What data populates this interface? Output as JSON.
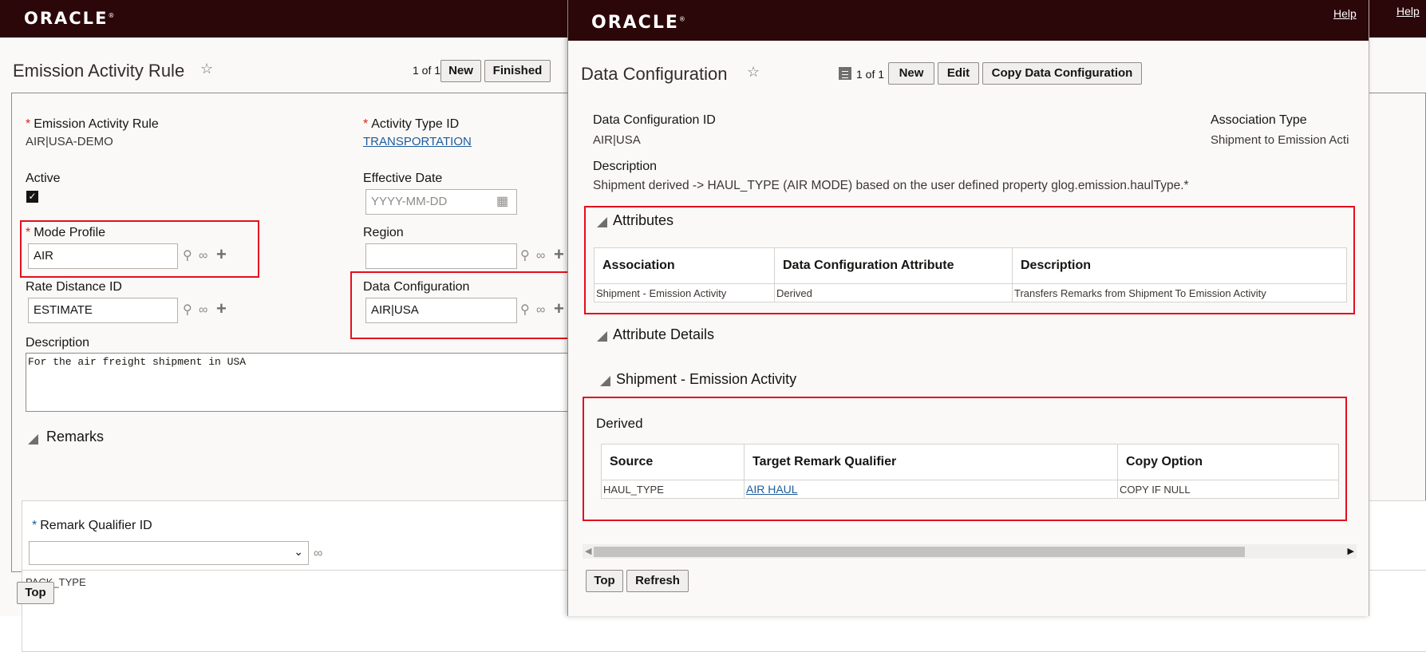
{
  "bg": {
    "logo": "ORACLE",
    "help": "Help",
    "title": "Emission Activity Rule",
    "pager": "1 of 1",
    "new_label": "New",
    "finished_label": "Finished",
    "fields": {
      "rule_label": "Emission Activity Rule",
      "rule_value": "AIR|USA-DEMO",
      "activity_type_label": "Activity Type ID",
      "activity_type_value": "TRANSPORTATION",
      "active_label": "Active",
      "active_checked": true,
      "effective_date_label": "Effective Date",
      "effective_date_placeholder": "YYYY-MM-DD",
      "mode_profile_label": "Mode Profile",
      "mode_profile_value": "AIR",
      "region_label": "Region",
      "region_value": "",
      "rate_distance_label": "Rate Distance ID",
      "rate_distance_value": "ESTIMATE",
      "data_config_label": "Data Configuration",
      "data_config_value": "AIR|USA",
      "description_label": "Description",
      "description_value": "For the air freight shipment in USA"
    },
    "remarks": {
      "section": "Remarks",
      "qualifier_label": "Remark Qualifier ID",
      "qualifier_value": "",
      "row_value": "PACK_TYPE"
    },
    "top_label": "Top"
  },
  "popup": {
    "logo": "ORACLE",
    "help": "Help",
    "title": "Data Configuration",
    "pager": "1 of 1",
    "new_label": "New",
    "edit_label": "Edit",
    "copy_label": "Copy Data Configuration",
    "id_label": "Data Configuration ID",
    "id_value": "AIR|USA",
    "assoc_type_label": "Association Type",
    "assoc_type_value": "Shipment to Emission Acti",
    "description_label": "Description",
    "description_value": "Shipment derived -> HAUL_TYPE (AIR MODE) based on the user defined property glog.emission.haulType.*",
    "attributes": {
      "section": "Attributes",
      "headers": [
        "Association",
        "Data Configuration Attribute",
        "Description"
      ],
      "rows": [
        [
          "Shipment - Emission Activity",
          "Derived",
          "Transfers Remarks from Shipment To Emission Activity"
        ]
      ]
    },
    "attribute_details_section": "Attribute Details",
    "shipment_section": "Shipment - Emission Activity",
    "derived": {
      "title": "Derived",
      "headers": [
        "Source",
        "Target Remark Qualifier",
        "Copy Option"
      ],
      "rows": [
        [
          "HAUL_TYPE",
          "AIR HAUL",
          "COPY IF NULL"
        ]
      ]
    },
    "top_label": "Top",
    "refresh_label": "Refresh"
  }
}
